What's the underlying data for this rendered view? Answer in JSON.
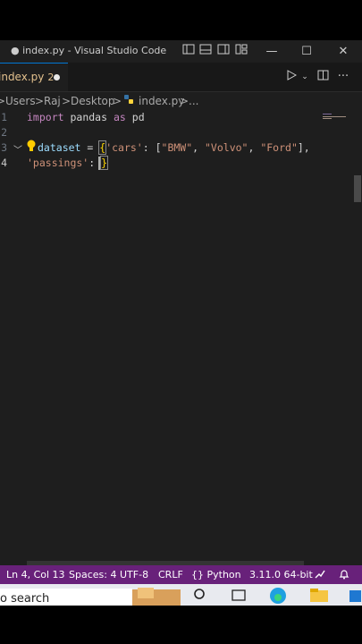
{
  "window": {
    "title": "● index.py - Visual Studio Code",
    "controls": {
      "minimize": "—",
      "maximize": "☐",
      "close": "✕"
    }
  },
  "tab": {
    "filename": "index.py",
    "problems": "2"
  },
  "breadcrumb": {
    "items": [
      "Users",
      "Raj",
      "Desktop",
      "index.py",
      "..."
    ],
    "separator": ">"
  },
  "editor": {
    "line_numbers": [
      "1",
      "2",
      "3",
      "4"
    ],
    "lines": {
      "l1": {
        "kw1": "import",
        "ident": "pandas",
        "kw2": "as",
        "alias": "pd"
      },
      "l3": {
        "var": "dataset",
        "assign": " = ",
        "open": "{",
        "key": "'cars'",
        "colon": ": [",
        "s1": "\"BMW\"",
        "c1": ", ",
        "s2": "\"Volvo\"",
        "c2": ", ",
        "s3": "\"Ford\"",
        "end": "],"
      },
      "l4": {
        "key": "'passings'",
        "colon": ": ",
        "close": "}"
      }
    }
  },
  "status": {
    "position": "Ln 4, Col 13",
    "spaces": "Spaces: 4",
    "encoding": "UTF-8",
    "eol": "CRLF",
    "language": "{} Python",
    "interpreter": "3.11.0 64-bit"
  },
  "taskbar": {
    "search_text": "o search"
  },
  "colors": {
    "status_bar": "#68217a",
    "accent": "#0078d4"
  }
}
